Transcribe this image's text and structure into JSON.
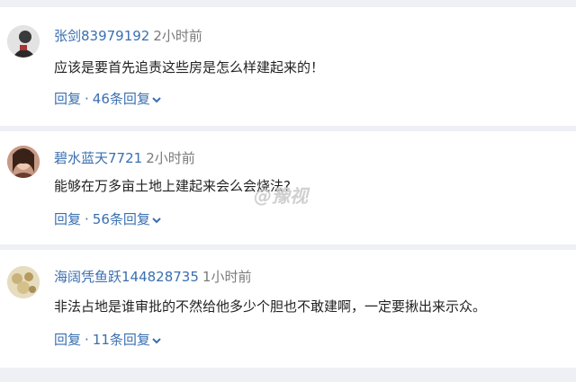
{
  "comments": [
    {
      "username": "张剑83979192",
      "time": "2小时前",
      "content": "应该是要首先追责这些房是怎么样建起来的！",
      "reply_label": "回复",
      "reply_separator": "·",
      "replies_count": "46条回复"
    },
    {
      "username": "碧水蓝天7721",
      "time": "2小时前",
      "content": "能够在万多亩土地上建起来会么会烧法?",
      "reply_label": "回复",
      "reply_separator": "·",
      "replies_count": "56条回复"
    },
    {
      "username": "海阔凭鱼跃144828735",
      "time": "1小时前",
      "content": "非法占地是谁审批的不然给他多少个胆也不敢建啊，一定要揪出来示众。",
      "reply_label": "回复",
      "reply_separator": "·",
      "replies_count": "11条回复"
    }
  ],
  "watermark": "@豫视",
  "colors": {
    "link": "#3a6fb0",
    "text": "#222222",
    "muted": "#7a7a7a",
    "background": "#eef0f5"
  },
  "icons": {
    "expand": "chevron-down-icon",
    "avatar": "avatar"
  }
}
